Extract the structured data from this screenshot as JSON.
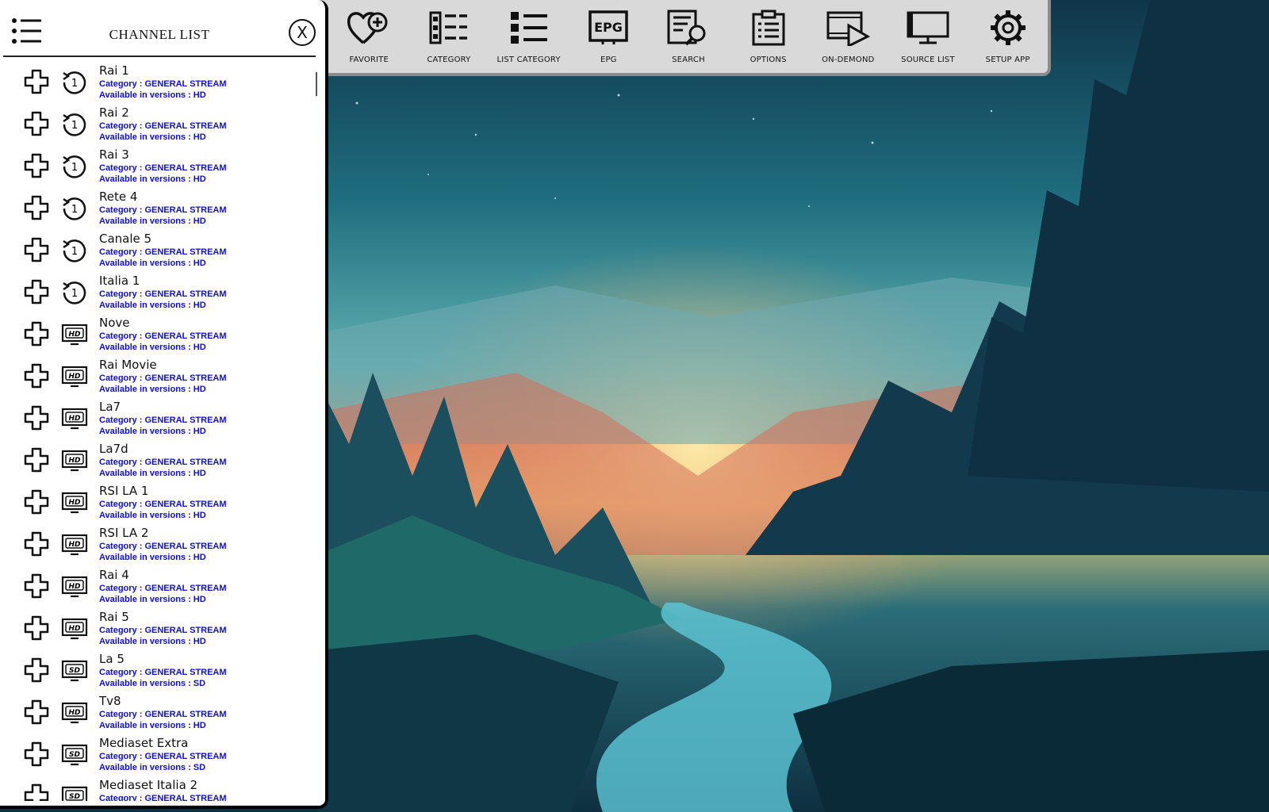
{
  "toolbar": {
    "items": [
      {
        "label": "FAVORITE",
        "icon": "heart-plus-icon"
      },
      {
        "label": "CATEGORY",
        "icon": "category-icon"
      },
      {
        "label": "LIST CATEGORY",
        "icon": "list-icon"
      },
      {
        "label": "EPG",
        "icon": "epg-icon"
      },
      {
        "label": "SEARCH",
        "icon": "search-icon"
      },
      {
        "label": "OPTIONS",
        "icon": "clipboard-icon"
      },
      {
        "label": "ON-DEMOND",
        "icon": "video-play-icon"
      },
      {
        "label": "SOURCE LIST",
        "icon": "monitor-icon"
      },
      {
        "label": "SETUP APP",
        "icon": "gear-icon"
      }
    ]
  },
  "panel": {
    "title": "CHANNEL LIST",
    "close_label": "X",
    "epg_badge": "EPG"
  },
  "channels": [
    {
      "name": "Rai 1",
      "category": "Category : GENERAL STREAM",
      "versions": "Available in versions :  HD",
      "icon": "replay-1-icon",
      "badge": "1"
    },
    {
      "name": "Rai 2",
      "category": "Category : GENERAL STREAM",
      "versions": "Available in versions :  HD",
      "icon": "replay-1-icon",
      "badge": "1"
    },
    {
      "name": "Rai 3",
      "category": "Category : GENERAL STREAM",
      "versions": "Available in versions :  HD",
      "icon": "replay-1-icon",
      "badge": "1"
    },
    {
      "name": "Rete 4",
      "category": "Category : GENERAL STREAM",
      "versions": "Available in versions :  HD",
      "icon": "replay-1-icon",
      "badge": "1"
    },
    {
      "name": "Canale 5",
      "category": "Category : GENERAL STREAM",
      "versions": "Available in versions :  HD",
      "icon": "replay-1-icon",
      "badge": "1"
    },
    {
      "name": "Italia 1",
      "category": "Category : GENERAL STREAM",
      "versions": "Available in versions :  HD",
      "icon": "replay-1-icon",
      "badge": "1"
    },
    {
      "name": "Nove",
      "category": "Category : GENERAL STREAM",
      "versions": "Available in versions : HD",
      "icon": "hd-tv-icon",
      "badge": "HD"
    },
    {
      "name": "Rai Movie",
      "category": "Category : GENERAL STREAM",
      "versions": "Available in versions : HD",
      "icon": "hd-tv-icon",
      "badge": "HD"
    },
    {
      "name": "La7",
      "category": "Category : GENERAL STREAM",
      "versions": "Available in versions : HD",
      "icon": "hd-tv-icon",
      "badge": "HD"
    },
    {
      "name": "La7d",
      "category": "Category : GENERAL STREAM",
      "versions": "Available in versions : HD",
      "icon": "hd-tv-icon",
      "badge": "HD"
    },
    {
      "name": "RSI LA 1",
      "category": "Category : GENERAL STREAM",
      "versions": "Available in versions : HD",
      "icon": "hd-tv-icon",
      "badge": "HD"
    },
    {
      "name": "RSI LA 2",
      "category": "Category : GENERAL STREAM",
      "versions": "Available in versions : HD",
      "icon": "hd-tv-icon",
      "badge": "HD"
    },
    {
      "name": "Rai 4",
      "category": "Category : GENERAL STREAM",
      "versions": "Available in versions : HD",
      "icon": "hd-tv-icon",
      "badge": "HD"
    },
    {
      "name": "Rai 5",
      "category": "Category : GENERAL STREAM",
      "versions": "Available in versions : HD",
      "icon": "hd-tv-icon",
      "badge": "HD"
    },
    {
      "name": "La 5",
      "category": "Category : GENERAL STREAM",
      "versions": "Available in versions : SD",
      "icon": "sd-tv-icon",
      "badge": "SD"
    },
    {
      "name": "Tv8",
      "category": "Category : GENERAL STREAM",
      "versions": "Available in versions : HD",
      "icon": "hd-tv-icon",
      "badge": "HD"
    },
    {
      "name": "Mediaset Extra",
      "category": "Category : GENERAL STREAM",
      "versions": "Available in versions : SD",
      "icon": "sd-tv-icon",
      "badge": "SD"
    },
    {
      "name": "Mediaset Italia 2",
      "category": "Category : GENERAL STREAM",
      "versions": "",
      "icon": "sd-tv-icon",
      "badge": "SD"
    }
  ],
  "colors": {
    "channel_meta": "#1010c8",
    "toolbar_bg": "#d9d9d9",
    "panel_bg": "#ffffff"
  }
}
